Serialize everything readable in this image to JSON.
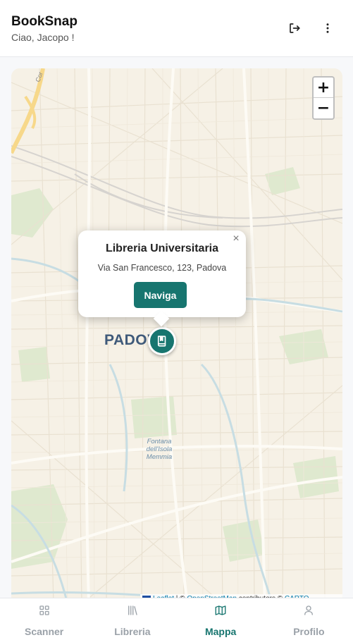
{
  "header": {
    "title": "BookSnap",
    "greeting": "Ciao, Jacopo !",
    "logout_icon": "logout-icon",
    "more_icon": "more-vertical-icon"
  },
  "map": {
    "zoom_in": "+",
    "zoom_out": "−",
    "city_label": "PADOVA",
    "poi_label": "Fontana dell'Isola Memmia",
    "road_label": "Cor",
    "marker_icon": "book-icon",
    "popup": {
      "title": "Libreria Universitaria",
      "address": "Via San Francesco, 123, Padova",
      "button": "Naviga",
      "close": "×"
    },
    "attribution": {
      "leaflet": "Leaflet",
      "separator": " | © ",
      "osm": "OpenStreetMap",
      "contributors": " contributors © ",
      "carto": "CARTO"
    }
  },
  "nav": {
    "items": [
      {
        "label": "Scanner",
        "icon": "grid-icon"
      },
      {
        "label": "Libreria",
        "icon": "library-icon"
      },
      {
        "label": "Mappa",
        "icon": "map-icon"
      },
      {
        "label": "Profilo",
        "icon": "user-icon"
      }
    ],
    "active": "Mappa"
  },
  "colors": {
    "accent": "#17756f",
    "map_background": "#f6f1e6",
    "inactive": "#9aa1a8"
  }
}
